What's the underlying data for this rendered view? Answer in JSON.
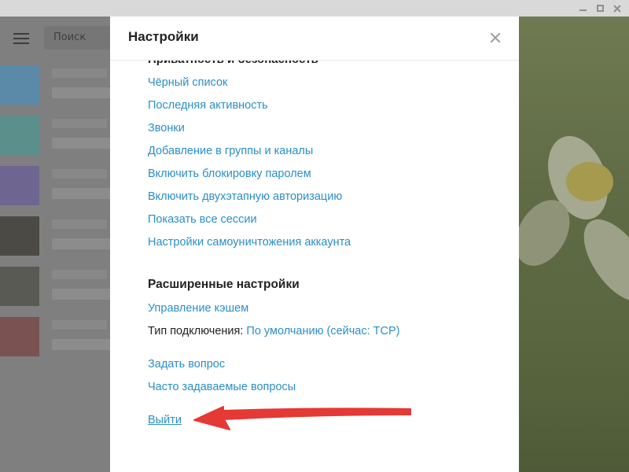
{
  "window": {
    "minimize_icon": "minimize-icon",
    "maximize_icon": "maximize-icon",
    "close_icon": "close-icon"
  },
  "sidebar": {
    "search_placeholder": "Поиск",
    "menu_icon": "hamburger-menu-icon"
  },
  "settings": {
    "title": "Настройки",
    "close_icon": "close-icon",
    "privacy_section_title": "Приватность и безопасность",
    "privacy_links": [
      "Чёрный список",
      "Последняя активность",
      "Звонки",
      "Добавление в группы и каналы",
      "Включить блокировку паролем",
      "Включить двухэтапную авторизацию",
      "Показать все сессии",
      "Настройки самоуничтожения аккаунта"
    ],
    "advanced_section_title": "Расширенные настройки",
    "cache_link": "Управление кэшем",
    "connection_label": "Тип подключения:",
    "connection_value": "По умолчанию (сейчас: TCP)",
    "ask_question_link": "Задать вопрос",
    "faq_link": "Часто задаваемые вопросы",
    "logout_link": "Выйти"
  },
  "colors": {
    "link": "#2a8fc7",
    "annotation_arrow": "#e53935",
    "titlebar": "#d9d9d9"
  }
}
